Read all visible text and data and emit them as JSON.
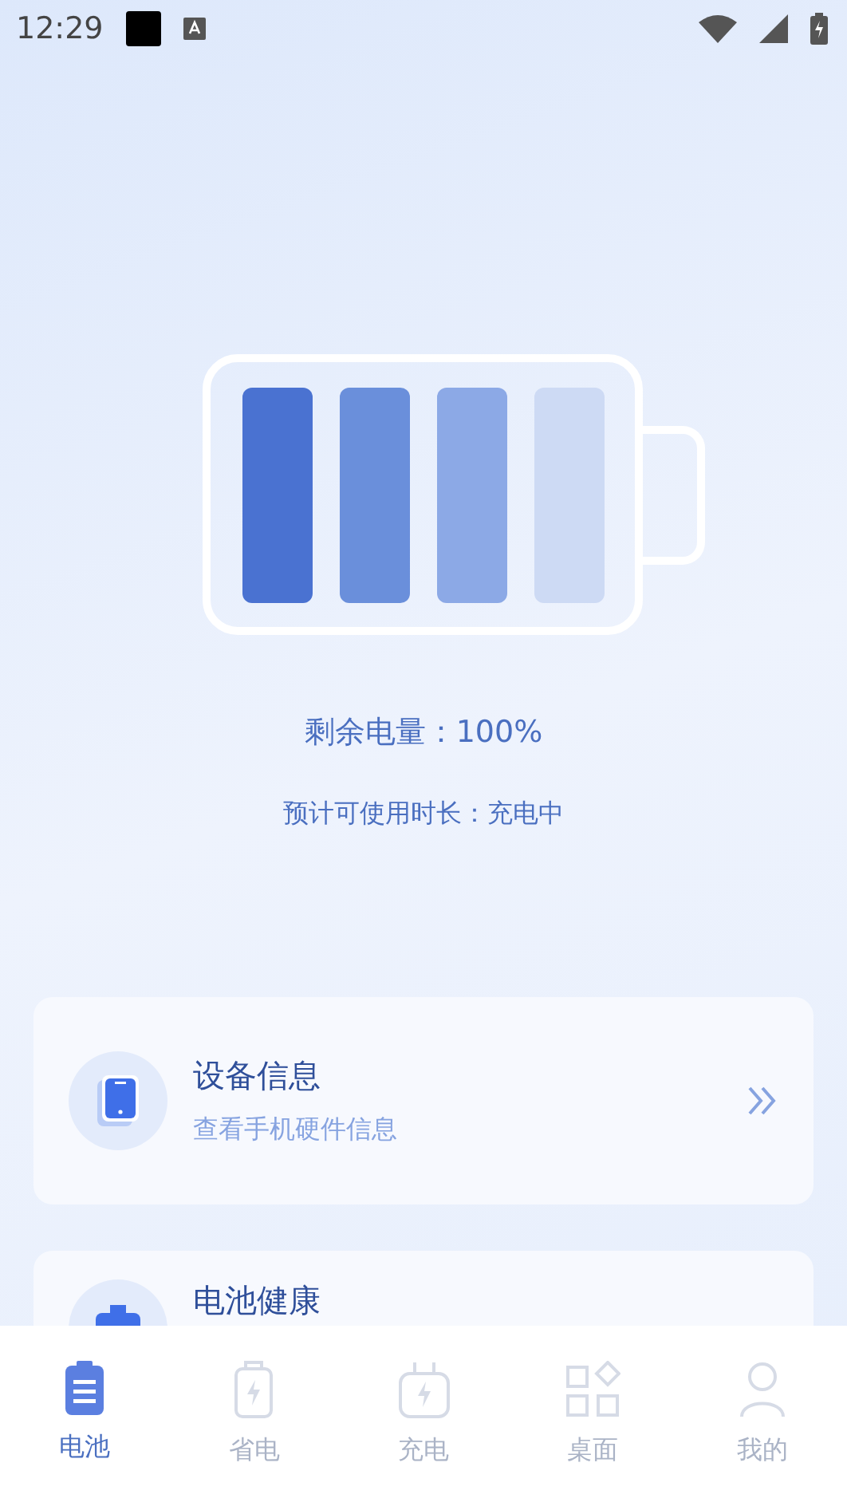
{
  "status_bar": {
    "time": "12:29"
  },
  "battery": {
    "remaining": "剩余电量：100%",
    "estimate": "预计可使用时长：充电中"
  },
  "cards": [
    {
      "kind": "device",
      "title": "设备信息",
      "subtitle": "查看手机硬件信息"
    },
    {
      "kind": "health",
      "title": "电池健康"
    }
  ],
  "tabs": [
    {
      "kind": "battery",
      "label": "电池",
      "selected": true
    },
    {
      "kind": "save",
      "label": "省电",
      "selected": false
    },
    {
      "kind": "charge",
      "label": "充电",
      "selected": false
    },
    {
      "kind": "desktop",
      "label": "桌面",
      "selected": false
    },
    {
      "kind": "me",
      "label": "我的",
      "selected": false
    }
  ]
}
